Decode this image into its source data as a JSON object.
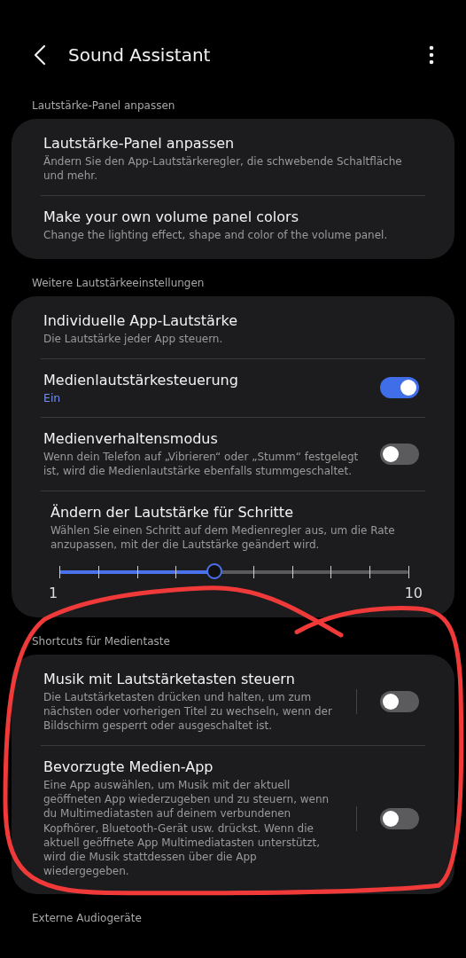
{
  "header": {
    "title": "Sound Assistant"
  },
  "sections": [
    {
      "heading": "Lautstärke-Panel anpassen",
      "rows": [
        {
          "kind": "link",
          "title": "Lautstärke-Panel anpassen",
          "subtitle": "Ändern Sie den App-Lautstärkeregler, die schwebende Schaltfläche und mehr."
        },
        {
          "kind": "link",
          "title": "Make your own volume panel colors",
          "subtitle": "Change the lighting effect, shape and color of the volume panel."
        }
      ]
    },
    {
      "heading": "Weitere Lautstärkeeinstellungen",
      "rows": [
        {
          "kind": "link",
          "title": "Individuelle App-Lautstärke",
          "subtitle": "Die Lautstärke jeder App steuern."
        },
        {
          "kind": "switch",
          "title": "Medienlautstärkesteuerung",
          "status": "Ein",
          "on": true
        },
        {
          "kind": "switch",
          "title": "Medienverhaltensmodus",
          "subtitle": "Wenn dein Telefon auf „Vibrieren“ oder „Stumm“ festgelegt ist, wird die Medienlautstärke ebenfalls stummgeschaltet.",
          "on": false
        },
        {
          "kind": "slider",
          "title": "Ändern der Lautstärke für Schritte",
          "subtitle": "Wählen Sie einen Schritt auf dem Medienregler aus, um die Rate anzupassen, mit der die Lautstärke geändert wird.",
          "level": 0.444,
          "min_label": "1",
          "max_label": "10"
        }
      ]
    },
    {
      "heading": "Shortcuts für Medientaste",
      "rows": [
        {
          "kind": "split-switch",
          "title": "Musik mit Lautstärketasten steuern",
          "subtitle": "Die Lautstärketasten drücken und halten, um zum nächsten oder vorherigen Titel zu wechseln, wenn der Bildschirm gesperrt oder ausgeschaltet ist.",
          "on": false
        },
        {
          "kind": "split-switch",
          "title": "Bevorzugte Medien-App",
          "subtitle": "Eine App auswählen, um Musik mit der aktuell geöffneten App wiederzugeben und zu steuern, wenn du Multimediatasten auf deinem verbundenen Kopfhörer, Bluetooth-Gerät usw. drückst. Wenn die aktuell geöffnete App Multimediatasten unterstützt, wird die Musik stattdessen über die App wiedergegeben.",
          "on": false
        }
      ]
    },
    {
      "heading": "Externe Audiogeräte"
    }
  ]
}
